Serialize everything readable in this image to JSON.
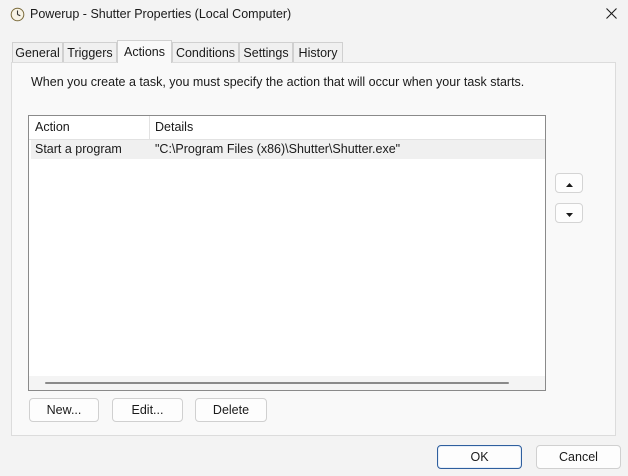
{
  "window": {
    "title": "Powerup - Shutter Properties (Local Computer)",
    "icon": "task-scheduler-clock-icon",
    "close_icon": "close-icon"
  },
  "tabs": [
    {
      "label": "General",
      "active": false
    },
    {
      "label": "Triggers",
      "active": false
    },
    {
      "label": "Actions",
      "active": true
    },
    {
      "label": "Conditions",
      "active": false
    },
    {
      "label": "Settings",
      "active": false
    },
    {
      "label": "History",
      "active": false
    }
  ],
  "actions_tab": {
    "instructions": "When you create a task, you must specify the action that will occur when your task starts.",
    "columns": [
      "Action",
      "Details"
    ],
    "rows": [
      {
        "action": "Start a program",
        "details": "\"C:\\Program Files (x86)\\Shutter\\Shutter.exe\""
      }
    ],
    "buttons": {
      "new": "New...",
      "edit": "Edit...",
      "delete": "Delete"
    },
    "move_up_icon": "arrow-up-icon",
    "move_down_icon": "arrow-down-icon"
  },
  "footer": {
    "ok": "OK",
    "cancel": "Cancel"
  },
  "colors": {
    "window_bg": "#f3f3f3",
    "panel_bg": "#f9f9f9",
    "selected_row": "#f0f0f0",
    "default_button_border": "#2f5f9e"
  }
}
